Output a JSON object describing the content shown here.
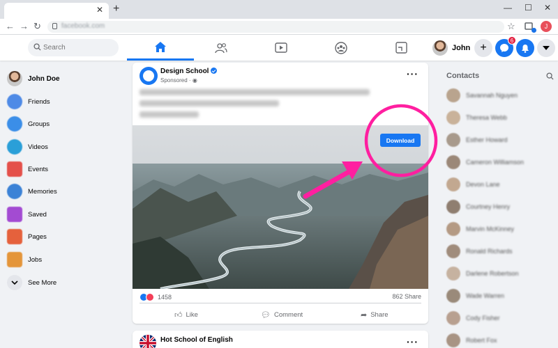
{
  "browser": {
    "tab_close": "✕",
    "new_tab": "+",
    "url": "facebook.com",
    "profile_initial": "J"
  },
  "header": {
    "search_placeholder": "Search",
    "user_name": "John",
    "messenger_badge": "6"
  },
  "sidebar": {
    "profile_name": "John Doe",
    "items": [
      {
        "label": "Friends",
        "color": "#4e8ae6"
      },
      {
        "label": "Groups",
        "color": "#3b8ee8"
      },
      {
        "label": "Videos",
        "color": "#2a9fd8"
      },
      {
        "label": "Events",
        "color": "#e4504a"
      },
      {
        "label": "Memories",
        "color": "#3b82d6"
      },
      {
        "label": "Saved",
        "color": "#a34bd2"
      },
      {
        "label": "Pages",
        "color": "#e5613c"
      },
      {
        "label": "Jobs",
        "color": "#e4953a"
      }
    ],
    "see_more": "See More"
  },
  "post1": {
    "page_name": "Design School",
    "sponsored": "Sponsored · ",
    "download_label": "Download",
    "reaction_count": "1458",
    "share_count": "862 Share",
    "like_label": "Like",
    "comment_label": "Comment",
    "share_label": "Share"
  },
  "post2": {
    "page_name": "Hot School of English"
  },
  "contacts": {
    "title": "Contacts",
    "people": [
      "Savannah Nguyen",
      "Theresa Webb",
      "Esther Howard",
      "Cameron Williamson",
      "Devon Lane",
      "Courtney Henry",
      "Marvin McKinney",
      "Ronald Richards",
      "Darlene Robertson",
      "Wade Warren",
      "Cody Fisher",
      "Robert Fox"
    ]
  },
  "colors": {
    "fb_blue": "#1877f2",
    "highlight": "#ff1fa0"
  }
}
